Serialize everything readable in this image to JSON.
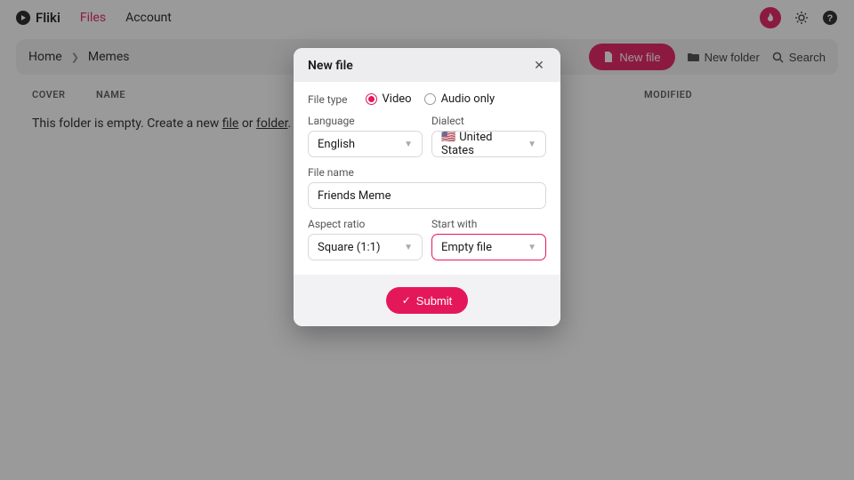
{
  "nav": {
    "brand": "Fliki",
    "files": "Files",
    "account": "Account"
  },
  "breadcrumb": {
    "home": "Home",
    "current": "Memes"
  },
  "toolbar": {
    "new_file": "New file",
    "new_folder": "New folder",
    "search": "Search"
  },
  "table": {
    "cover": "COVER",
    "name": "NAME",
    "modified": "MODIFIED"
  },
  "empty": {
    "prefix": "This folder is empty. Create a new ",
    "file": "file",
    "mid": " or ",
    "folder": "folder",
    "suffix": "."
  },
  "modal": {
    "title": "New file",
    "file_type_label": "File type",
    "opt_video": "Video",
    "opt_audio": "Audio only",
    "language_label": "Language",
    "language_value": "English",
    "dialect_label": "Dialect",
    "dialect_value": "United States",
    "dialect_flag": "🇺🇸",
    "filename_label": "File name",
    "filename_value": "Friends Meme",
    "aspect_label": "Aspect ratio",
    "aspect_value": "Square (1:1)",
    "startwith_label": "Start with",
    "startwith_value": "Empty file",
    "submit": "Submit"
  }
}
